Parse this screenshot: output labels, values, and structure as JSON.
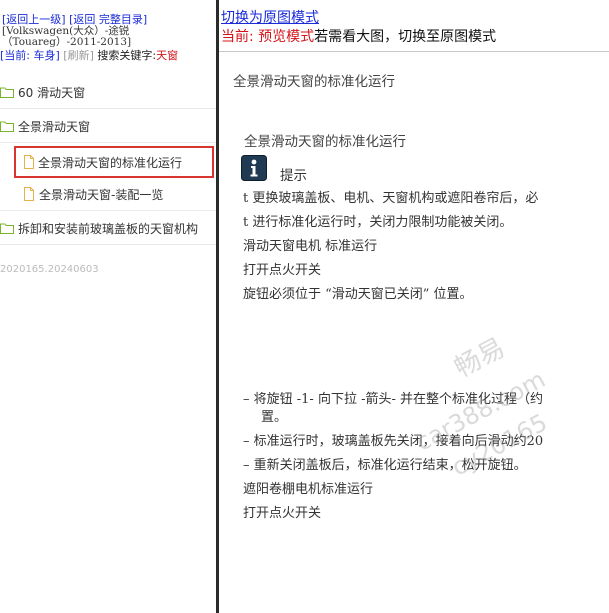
{
  "nav": {
    "back_up": "[返回上一级]",
    "back_catalog": "[返回 完整目录]",
    "car": "[Volkswagen(大众）-途锐（Touareg）-2011-2013]",
    "current_prefix": "[当前: 车身]",
    "refresh": "[刷新]",
    "search_label": "搜索关键字:",
    "search_value": "天窗"
  },
  "tree": [
    {
      "label": "60 滑动天窗",
      "icon": "folder-icon"
    },
    {
      "label": "全景滑动天窗",
      "icon": "folder-open-icon"
    },
    {
      "label": "全景滑动天窗的标准化运行",
      "icon": "document-icon",
      "selected": true
    },
    {
      "label": "全景滑动天窗-装配一览",
      "icon": "document-icon"
    },
    {
      "label": "拆卸和安装前玻璃盖板的天窗机构",
      "icon": "folder-icon"
    }
  ],
  "footer_code": "2020165.20240603",
  "right": {
    "switch_link": "切换为原图模式",
    "mode_prefix": "当前: 预览模式",
    "mode_suffix": "若需看大图，切换至原图模式"
  },
  "doc": {
    "header": "全景滑动天窗的标准化运行",
    "title": "全景滑动天窗的标准化运行",
    "tip": "提示",
    "bullets": [
      "t 更换玻璃盖板、电机、天窗机构或遮阳卷帘后，必",
      "t 进行标准化运行时，关闭力限制功能被关闭。"
    ],
    "lines_a": [
      "滑动天窗电机 标准运行",
      "打开点火开关",
      "旋钮必须位于 “滑动天窗已关闭” 位置。"
    ],
    "steps": [
      "– 将旋钮 -1- 向下拉 -箭头- 并在整个标准化过程（约",
      "置。",
      "– 标准运行时，玻璃盖板先关闭，接着向后滑动约20",
      "– 重新关闭盖板后，标准化运行结束，松开旋钮。"
    ],
    "lines_b": [
      "遮阳卷棚电机标准运行",
      "打开点火开关"
    ]
  },
  "watermark": [
    "畅易",
    "car388.com",
    "cy20165"
  ]
}
